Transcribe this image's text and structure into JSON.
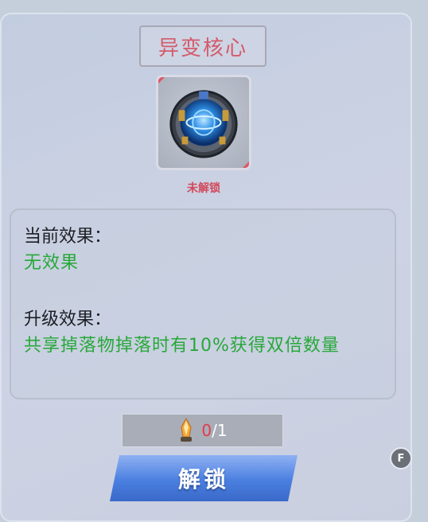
{
  "panel": {
    "title": "异变核心",
    "status": "未解锁",
    "current_effect_label": "当前效果：",
    "current_effect_value": "无效果",
    "upgrade_effect_label": "升级效果：",
    "upgrade_effect_value": "共享掉落物掉落时有10%获得双倍数量"
  },
  "cost": {
    "have": "0",
    "need": "/1",
    "icon": "crystal-shard-icon"
  },
  "unlock_button": {
    "label": "解锁"
  },
  "hotkey_badge": {
    "label": "F"
  },
  "colors": {
    "title": "#d45b6b",
    "status": "#d2495b",
    "effect_value": "#27a83a",
    "cost_have": "#e23c49",
    "button": "#4a7fe0"
  }
}
